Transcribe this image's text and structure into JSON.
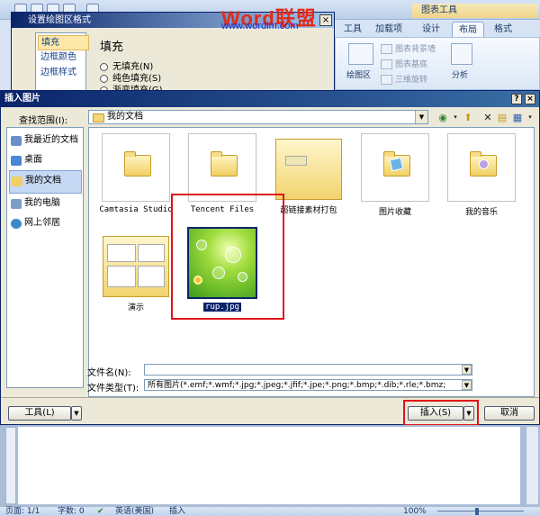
{
  "watermark": {
    "logo_word": "Word",
    "logo_cn": "联盟",
    "url": "www.wordlm.com"
  },
  "ribbon": {
    "context_title": "图表工具",
    "tabs": [
      "工具",
      "加载项",
      "设计",
      "布局",
      "格式"
    ],
    "group_plot_area": "绘图区",
    "items": [
      "图表背景墙",
      "图表基底",
      "三维旋转"
    ],
    "analysis": "分析"
  },
  "format_dialog": {
    "title": "设置绘图区格式",
    "categories": [
      "填充",
      "边框颜色",
      "边框样式"
    ],
    "heading": "填充",
    "options": [
      "无填充(N)",
      "纯色填充(S)",
      "渐变填充(G)"
    ]
  },
  "insert_dialog": {
    "title": "插入图片",
    "help": "?",
    "close": "×",
    "look_in_label": "查找范围(I):",
    "look_in_value": "我的文档",
    "places": [
      "我最近的文档",
      "桌面",
      "我的文档",
      "我的电脑",
      "网上邻居"
    ],
    "files": [
      {
        "name": "Camtasia Studio"
      },
      {
        "name": "Tencent Files"
      },
      {
        "name": "超链接素材打包"
      },
      {
        "name": "图片收藏"
      },
      {
        "name": "我的音乐"
      },
      {
        "name": "演示"
      },
      {
        "name": "rup.jpg"
      }
    ],
    "filename_label": "文件名(N):",
    "filename_value": "",
    "filetype_label": "文件类型(T):",
    "filetype_value": "所有图片(*.emf;*.wmf;*.jpg;*.jpeg;*.jfif;*.jpe;*.png;*.bmp;*.dib;*.rle;*.bmz;",
    "tools_button": "工具(L)",
    "insert_button": "插入(S)",
    "cancel_button": "取消"
  },
  "status_bar": {
    "page": "页面: 1/1",
    "words": "字数: 0",
    "language": "英语(美国)",
    "mode": "插入",
    "zoom": "100%"
  },
  "colors": {
    "title_bar": "#0a246a",
    "highlight_red": "#e0121c",
    "selection": "#0a246a"
  }
}
